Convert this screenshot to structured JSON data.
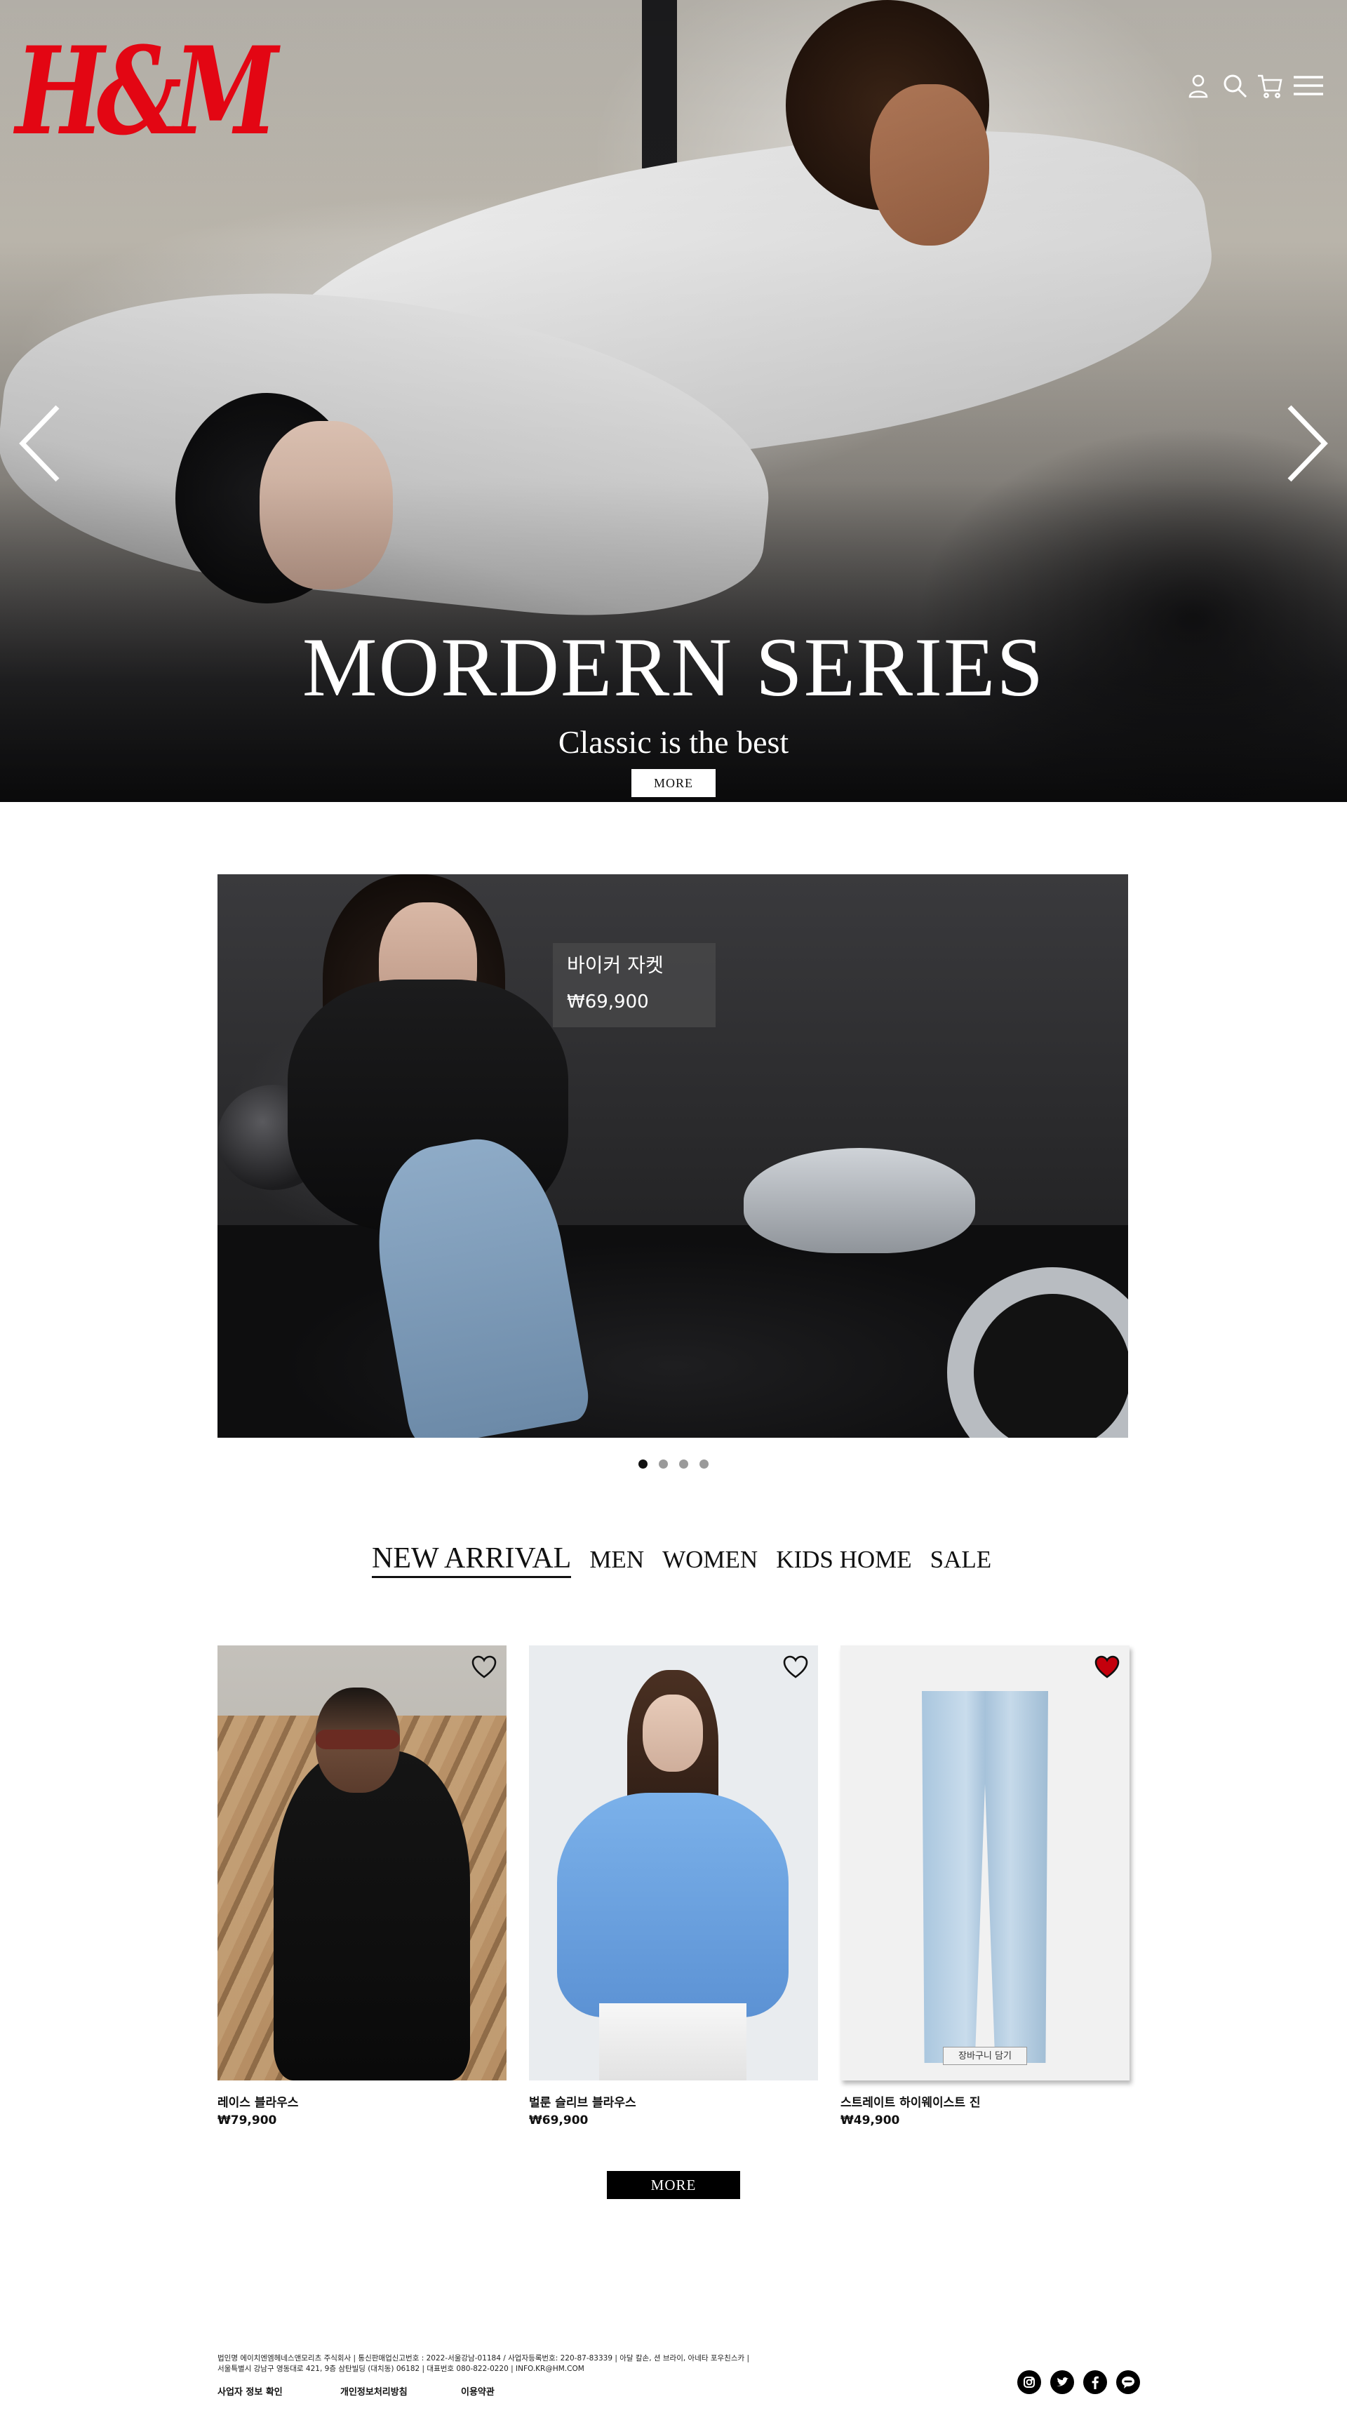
{
  "brand": {
    "logo_text": "H&M",
    "logo_color": "#e30613"
  },
  "header": {
    "icons": [
      "user-icon",
      "search-icon",
      "cart-icon",
      "menu-icon"
    ]
  },
  "hero": {
    "title": "MORDERN SERIES",
    "subtitle": "Classic is the best",
    "button_label": "MORE",
    "prev_icon": "chevron-left-icon",
    "next_icon": "chevron-right-icon"
  },
  "featured": {
    "product_name": "바이커 자켓",
    "product_price": "₩69,900",
    "slide_count": 4,
    "active_slide": 1
  },
  "categories": {
    "items": [
      "NEW ARRIVAL",
      "MEN",
      "WOMEN",
      "KIDS HOME",
      "SALE"
    ],
    "active": "NEW ARRIVAL"
  },
  "products": [
    {
      "name": "레이스 블라우스",
      "price": "₩79,900",
      "liked": false
    },
    {
      "name": "벌룬 슬리브 블라우스",
      "price": "₩69,900",
      "liked": false
    },
    {
      "name": "스트레이트 하이웨이스트 진",
      "price": "₩49,900",
      "liked": true,
      "cart_label": "장바구니 담기"
    }
  ],
  "more_button_label": "MORE",
  "footer": {
    "info_line1": "법인명 에이치엔엠헤네스앤모리츠 주식회사 | 통신판매업신고번호 : 2022-서울강남-01184 / 사업자등록번호: 220-87-83339 | 아달 칼손, 션 브라이, 아네타 포우친스카 |",
    "info_line2": "서울특별시 강남구 영동대로 421, 9층 삼탄빌딩 (대치동) 06182 | 대표번호 080-822-0220 | INFO.KR@HM.COM",
    "links": [
      "사업자 정보 확인",
      "개인정보처리방침",
      "이용약관"
    ],
    "social_icons": [
      "instagram-icon",
      "twitter-icon",
      "facebook-icon",
      "chat-icon"
    ]
  },
  "colors": {
    "accent_red": "#e30613",
    "liked_heart": "#c4000c",
    "text": "#111111"
  }
}
